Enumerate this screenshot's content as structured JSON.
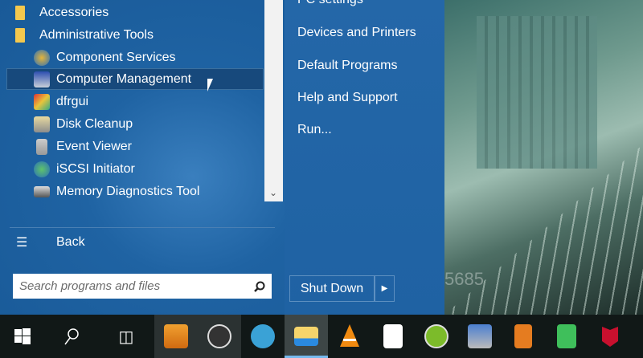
{
  "programs": [
    {
      "label": "Accessories",
      "icon": "folder-icon"
    },
    {
      "label": "Administrative Tools",
      "icon": "folder-icon"
    },
    {
      "label": "Component Services",
      "icon": "component-services-icon"
    },
    {
      "label": "Computer Management",
      "icon": "computer-management-icon",
      "selected": true
    },
    {
      "label": "dfrgui",
      "icon": "defrag-icon"
    },
    {
      "label": "Disk Cleanup",
      "icon": "disk-cleanup-icon"
    },
    {
      "label": "Event Viewer",
      "icon": "event-viewer-icon"
    },
    {
      "label": "iSCSI Initiator",
      "icon": "iscsi-icon"
    },
    {
      "label": "Memory Diagnostics Tool",
      "icon": "memory-diagnostics-icon"
    }
  ],
  "back_label": "Back",
  "search_placeholder": "Search programs and files",
  "right_items": [
    "PC settings",
    "Devices and Printers",
    "Default Programs",
    "Help and Support",
    "Run..."
  ],
  "shutdown_label": "Shut Down",
  "photo_text": "5685",
  "taskbar": [
    "start",
    "search",
    "task-view",
    "clock-app",
    "obs",
    "browser",
    "file-explorer",
    "vlc",
    "store",
    "app-green",
    "remote-desktop",
    "media-player",
    "sheets",
    "mcafee"
  ]
}
